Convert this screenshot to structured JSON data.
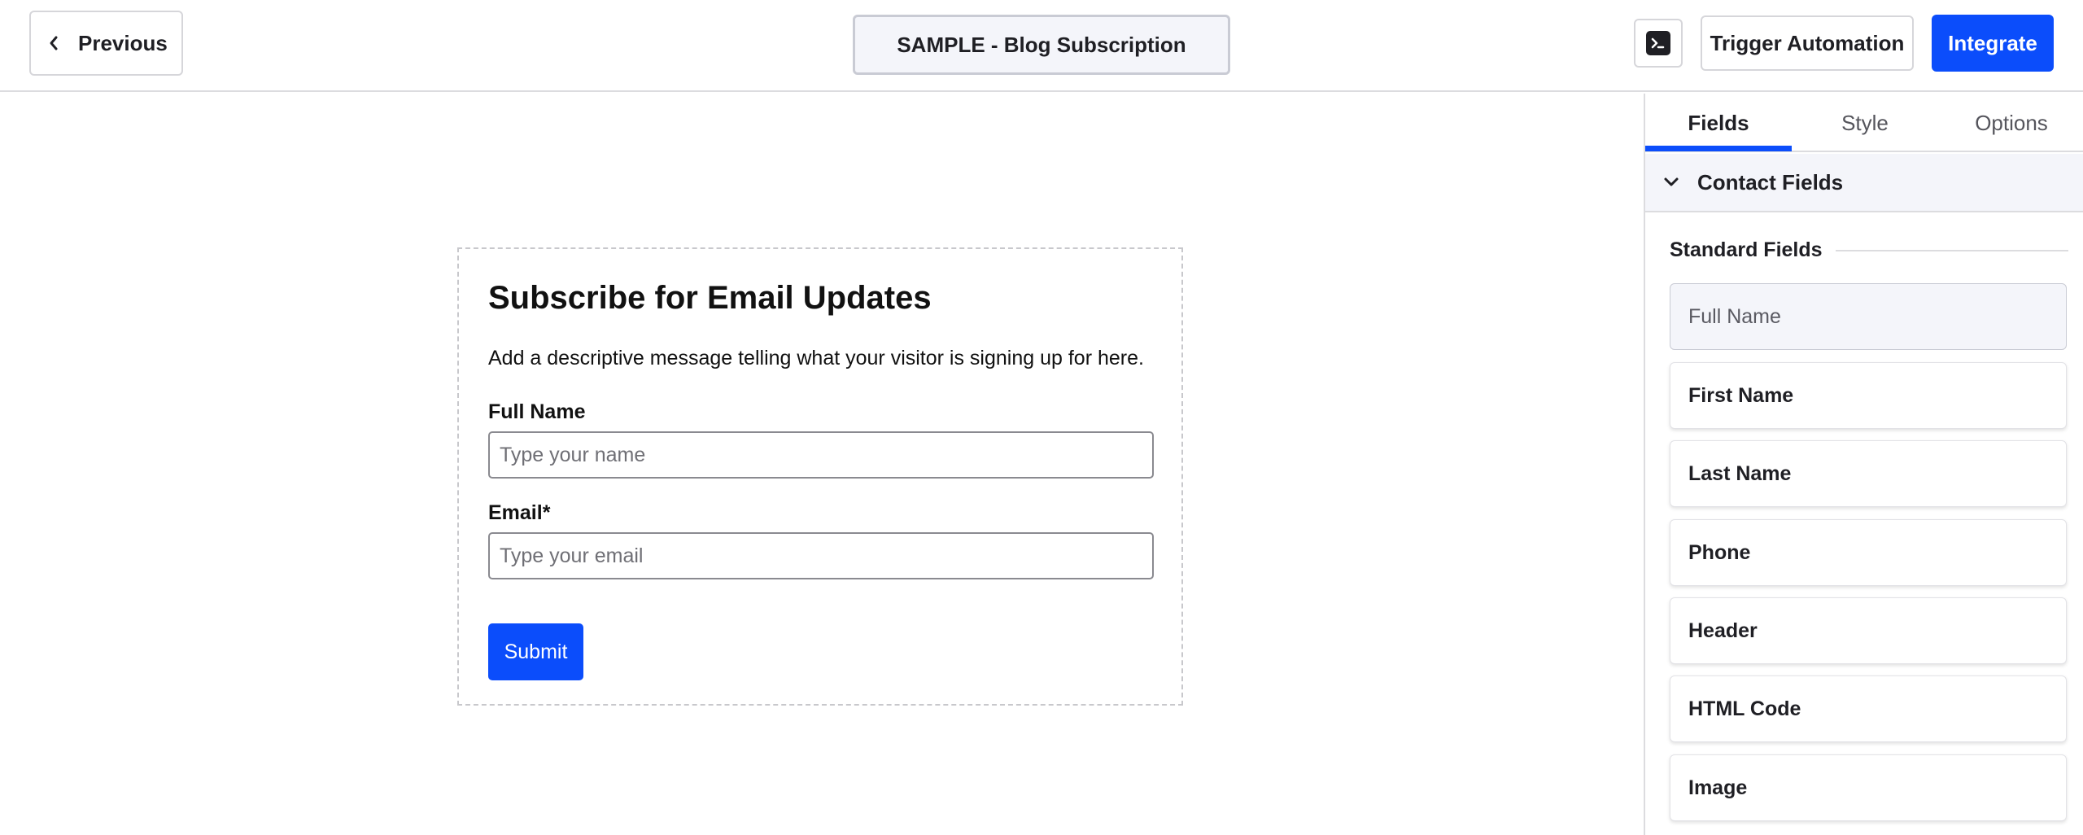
{
  "topbar": {
    "previous_label": "Previous",
    "form_title": "SAMPLE - Blog Subscription",
    "terminal_icon": "terminal-icon",
    "trigger_label": "Trigger Automation",
    "integrate_label": "Integrate",
    "accent": "#0b4dfb"
  },
  "form": {
    "title": "Subscribe for Email Updates",
    "description": "Add a descriptive message telling what your visitor is signing up for here.",
    "fields": [
      {
        "label": "Full Name",
        "placeholder": "Type your name"
      },
      {
        "label": "Email*",
        "placeholder": "Type your email"
      }
    ],
    "submit_label": "Submit"
  },
  "sidebar": {
    "tabs": [
      {
        "label": "Fields",
        "active": true
      },
      {
        "label": "Style",
        "active": false
      },
      {
        "label": "Options",
        "active": false
      }
    ],
    "section_title": "Contact Fields",
    "group_title": "Standard Fields",
    "items": [
      {
        "label": "Full Name",
        "disabled": true
      },
      {
        "label": "First Name",
        "disabled": false
      },
      {
        "label": "Last Name",
        "disabled": false
      },
      {
        "label": "Phone",
        "disabled": false
      },
      {
        "label": "Header",
        "disabled": false
      },
      {
        "label": "HTML Code",
        "disabled": false
      },
      {
        "label": "Image",
        "disabled": false
      }
    ]
  }
}
